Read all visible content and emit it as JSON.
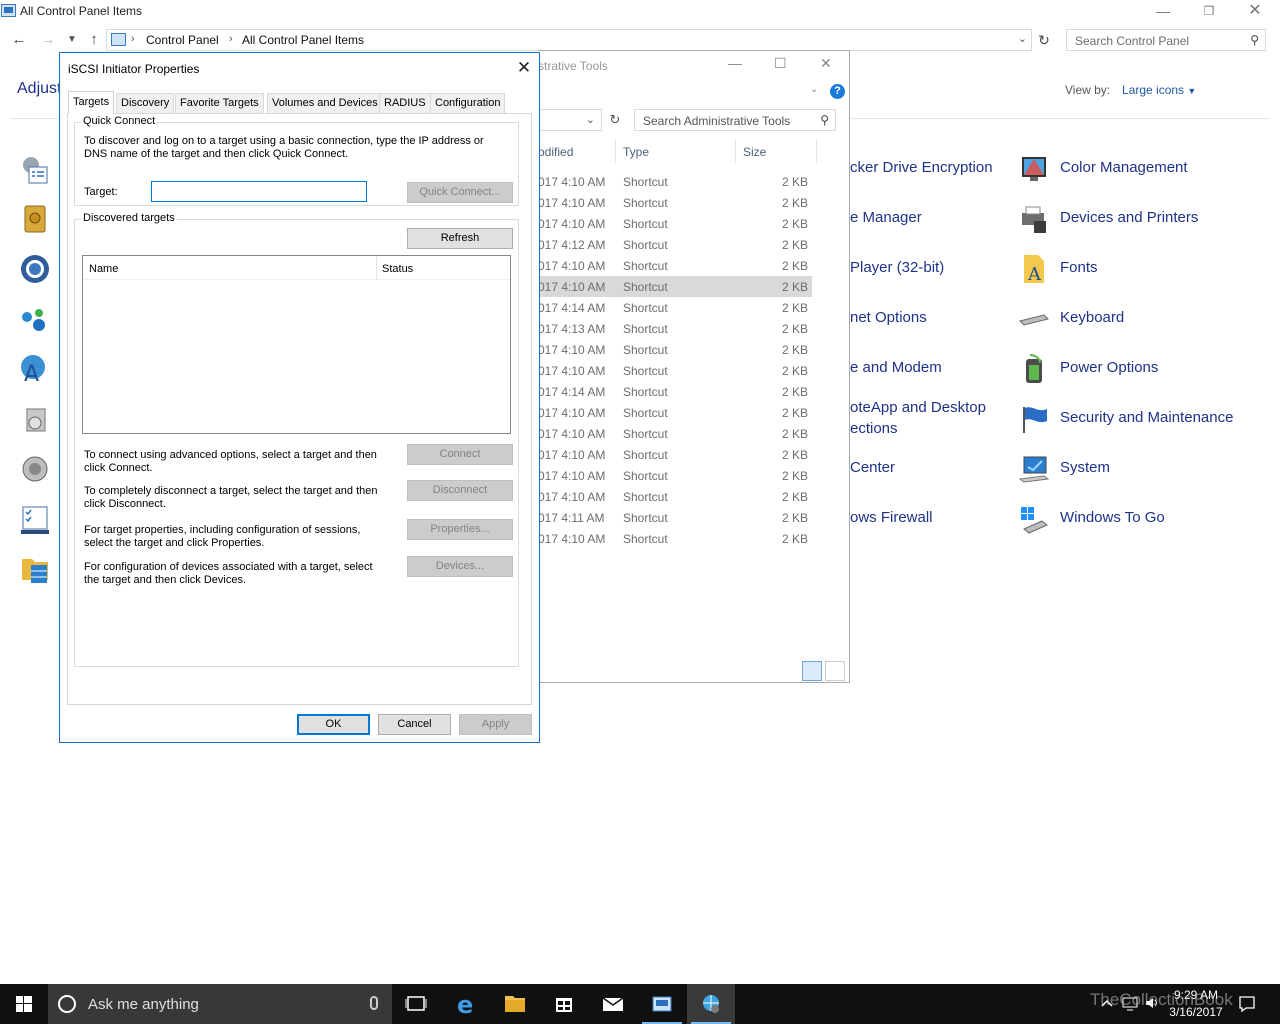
{
  "control_panel": {
    "window_title": "All Control Panel Items",
    "breadcrumb": [
      "Control Panel",
      "All Control Panel Items"
    ],
    "search_placeholder": "Search Control Panel",
    "heading": "Adjust",
    "view_by_label": "View by:",
    "view_by_value": "Large icons",
    "items": [
      {
        "label": "cker Drive Encryption",
        "icon": "bitlocker-icon"
      },
      {
        "label": "e Manager",
        "icon": "device-manager-icon"
      },
      {
        "label": "Player (32-bit)",
        "icon": "flash-player-icon"
      },
      {
        "label": "net Options",
        "icon": "internet-options-icon"
      },
      {
        "label": "e and Modem",
        "icon": "phone-modem-icon"
      },
      {
        "label": "oteApp and Desktop",
        "label2": "ections",
        "icon": "remoteapp-icon"
      },
      {
        "label": "Center",
        "icon": "sync-center-icon"
      },
      {
        "label": "ows Firewall",
        "icon": "firewall-icon"
      },
      {
        "label": "Color Management",
        "icon": "color-management-icon"
      },
      {
        "label": "Devices and Printers",
        "icon": "devices-printers-icon"
      },
      {
        "label": "Fonts",
        "icon": "fonts-icon"
      },
      {
        "label": "Keyboard",
        "icon": "keyboard-icon"
      },
      {
        "label": "Power Options",
        "icon": "power-options-icon"
      },
      {
        "label": "Security and Maintenance",
        "icon": "security-flag-icon"
      },
      {
        "label": "System",
        "icon": "system-icon"
      },
      {
        "label": "Windows To Go",
        "icon": "windows-to-go-icon"
      }
    ]
  },
  "admin_tools": {
    "title_fragment": "strative Tools",
    "search_placeholder": "Search Administrative Tools",
    "columns": [
      "odified",
      "Type",
      "Size"
    ],
    "rows": [
      {
        "modified": "017 4:10 AM",
        "type": "Shortcut",
        "size": "2 KB"
      },
      {
        "modified": "017 4:10 AM",
        "type": "Shortcut",
        "size": "2 KB"
      },
      {
        "modified": "017 4:10 AM",
        "type": "Shortcut",
        "size": "2 KB"
      },
      {
        "modified": "017 4:12 AM",
        "type": "Shortcut",
        "size": "2 KB"
      },
      {
        "modified": "017 4:10 AM",
        "type": "Shortcut",
        "size": "2 KB"
      },
      {
        "modified": "017 4:10 AM",
        "type": "Shortcut",
        "size": "2 KB",
        "selected": true
      },
      {
        "modified": "017 4:14 AM",
        "type": "Shortcut",
        "size": "2 KB"
      },
      {
        "modified": "017 4:13 AM",
        "type": "Shortcut",
        "size": "2 KB"
      },
      {
        "modified": "017 4:10 AM",
        "type": "Shortcut",
        "size": "2 KB"
      },
      {
        "modified": "017 4:10 AM",
        "type": "Shortcut",
        "size": "2 KB"
      },
      {
        "modified": "017 4:14 AM",
        "type": "Shortcut",
        "size": "2 KB"
      },
      {
        "modified": "017 4:10 AM",
        "type": "Shortcut",
        "size": "2 KB"
      },
      {
        "modified": "017 4:10 AM",
        "type": "Shortcut",
        "size": "2 KB"
      },
      {
        "modified": "017 4:10 AM",
        "type": "Shortcut",
        "size": "2 KB"
      },
      {
        "modified": "017 4:10 AM",
        "type": "Shortcut",
        "size": "2 KB"
      },
      {
        "modified": "017 4:10 AM",
        "type": "Shortcut",
        "size": "2 KB"
      },
      {
        "modified": "017 4:11 AM",
        "type": "Shortcut",
        "size": "2 KB"
      },
      {
        "modified": "017 4:10 AM",
        "type": "Shortcut",
        "size": "2 KB"
      }
    ]
  },
  "dialog": {
    "title": "iSCSI Initiator Properties",
    "tabs": [
      "Targets",
      "Discovery",
      "Favorite Targets",
      "Volumes and Devices",
      "RADIUS",
      "Configuration"
    ],
    "active_tab": "Targets",
    "quick_connect": {
      "group_label": "Quick Connect",
      "description": "To discover and log on to a target using a basic connection, type the IP address or DNS name of the target and then click Quick Connect.",
      "target_label": "Target:",
      "target_value": "",
      "button": "Quick Connect..."
    },
    "discovered": {
      "group_label": "Discovered targets",
      "refresh_button": "Refresh",
      "columns": [
        "Name",
        "Status"
      ],
      "actions": [
        {
          "text": "To connect using advanced options, select a target and then click Connect.",
          "button": "Connect"
        },
        {
          "text": "To completely disconnect a target, select the target and then click Disconnect.",
          "button": "Disconnect"
        },
        {
          "text": "For target properties, including configuration of sessions, select the target and click Properties.",
          "button": "Properties..."
        },
        {
          "text": "For configuration of devices associated with a target, select the target and then click Devices.",
          "button": "Devices..."
        }
      ]
    },
    "ok": "OK",
    "cancel": "Cancel",
    "apply": "Apply"
  },
  "taskbar": {
    "search_placeholder": "Ask me anything",
    "time": "9:29 AM",
    "date": "3/16/2017",
    "watermark": "TheCollectionBook",
    "accent": "#76b9ed"
  }
}
